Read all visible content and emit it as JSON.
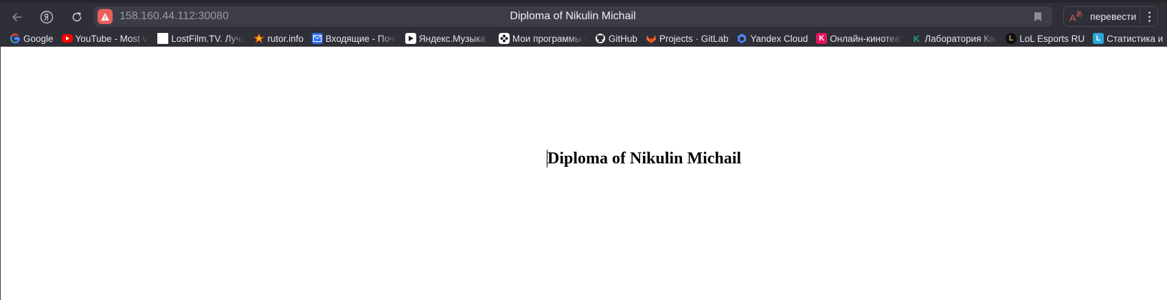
{
  "browser": {
    "url": "158.160.44.112:30080",
    "tab_title": "Diploma of Nikulin Michail",
    "translate_label": "перевести",
    "colors": {
      "toolbar": "#2f2f38",
      "omnibox": "#3d3d47",
      "warning": "#e8615b"
    }
  },
  "bookmarks": [
    {
      "label": "Google",
      "icon": "google-icon"
    },
    {
      "label": "YouTube - Most vi",
      "icon": "youtube-icon"
    },
    {
      "label": "LostFilm.TV. Лучш",
      "icon": "lostfilm-icon"
    },
    {
      "label": "rutor.info",
      "icon": "rutor-icon"
    },
    {
      "label": "Входящие - Почта",
      "icon": "mail-icon"
    },
    {
      "label": "Яндекс.Музыка –",
      "icon": "yandex-music-icon"
    },
    {
      "label": "Мои программы с",
      "icon": "programs-icon"
    },
    {
      "label": "GitHub",
      "icon": "github-icon"
    },
    {
      "label": "Projects · GitLab",
      "icon": "gitlab-icon"
    },
    {
      "label": "Yandex Cloud",
      "icon": "yandex-cloud-icon"
    },
    {
      "label": "Онлайн-кинотеат",
      "icon": "kinopoisk-icon"
    },
    {
      "label": "Лаборатория Кас",
      "icon": "kaspersky-icon"
    },
    {
      "label": "LoL Esports RU",
      "icon": "lol-esports-icon"
    },
    {
      "label": "Статистика и",
      "icon": "statistics-icon"
    }
  ],
  "page": {
    "heading": "Diploma of Nikulin Michail"
  }
}
